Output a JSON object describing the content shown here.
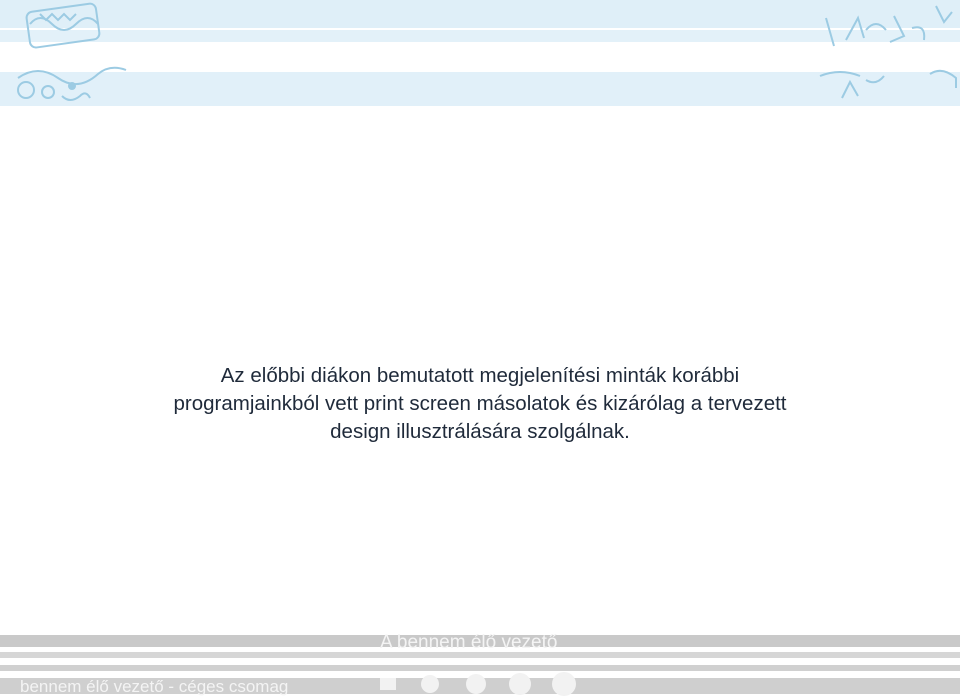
{
  "slide": {
    "disclaimer_lines": [
      "Az előbbi diákon bemutatott megjelenítési minták korábbi",
      "programjainkból vett print screen másolatok és kizárólag a tervezett",
      "design illusztrálására szolgálnak."
    ]
  },
  "footer": {
    "title": "A bennem élő vezető",
    "subtitle": "bennem élő vezető - céges csomag"
  },
  "colors": {
    "band_blue": "#e1f0f9",
    "art_blue": "#9ccbe3",
    "band_grey": "#cfcfcf",
    "text": "#1f2a3a"
  },
  "icons": [
    "ornament-left-icon",
    "ornament-right-icon",
    "progress-dots-icon"
  ]
}
